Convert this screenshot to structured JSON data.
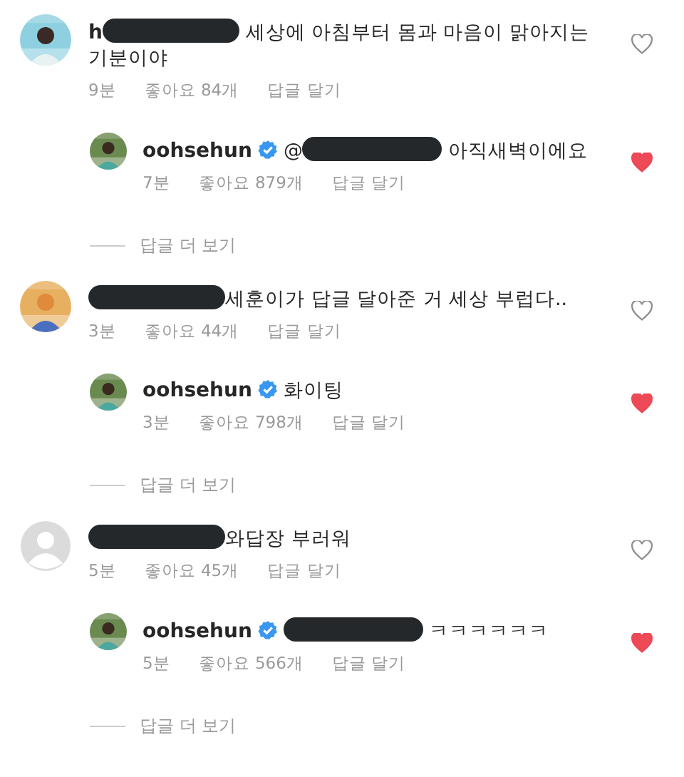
{
  "comments": [
    {
      "username": "h",
      "redacted": true,
      "text": " 세상에 아침부터 몸과 마음이 맑아지는",
      "text_continued": "기분이야",
      "time": "9분",
      "likes": "좋아요 84개",
      "reply_label": "답글 달기",
      "liked": false,
      "replies": [
        {
          "username": "oohsehun",
          "verified": true,
          "mention": "@",
          "redacted": true,
          "text": " 아직새벽이에요",
          "time": "7분",
          "likes": "좋아요 879개",
          "reply_label": "답글 달기",
          "liked": true
        }
      ],
      "more_replies": "답글 더 보기"
    },
    {
      "redacted": true,
      "text": "세훈이가 답글 달아준 거 세상 부럽다..",
      "time": "3분",
      "likes": "좋아요 44개",
      "reply_label": "답글 달기",
      "liked": false,
      "replies": [
        {
          "username": "oohsehun",
          "verified": true,
          "text": "화이팅",
          "time": "3분",
          "likes": "좋아요 798개",
          "reply_label": "답글 달기",
          "liked": true
        }
      ],
      "more_replies": "답글 더 보기"
    },
    {
      "avatar": {
        "kind": "default"
      },
      "redacted": true,
      "text": "와답장 부러워",
      "time": "5분",
      "likes": "좋아요 45개",
      "reply_label": "답글 달기",
      "liked": false,
      "replies": [
        {
          "username": "oohsehun",
          "verified": true,
          "redacted": true,
          "text": " ㅋㅋㅋㅋㅋㅋ",
          "time": "5분",
          "likes": "좋아요 566개",
          "reply_label": "답글 달기",
          "liked": true
        }
      ],
      "more_replies": "답글 더 보기"
    }
  ]
}
